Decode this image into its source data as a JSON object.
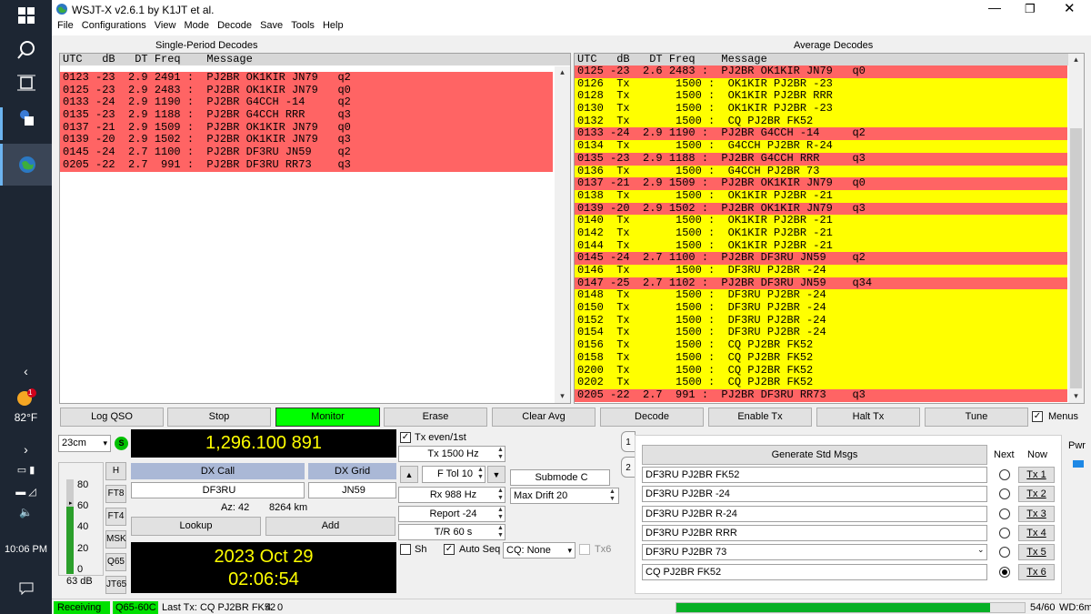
{
  "app": {
    "title": "WSJT-X   v2.6.1   by K1JT et al.",
    "menus": [
      "File",
      "Configurations",
      "View",
      "Mode",
      "Decode",
      "Save",
      "Tools",
      "Help"
    ]
  },
  "taskbar": {
    "temperature": "82°F",
    "time": "10:06 PM",
    "badge": "1"
  },
  "left_pane": {
    "title": "Single-Period Decodes",
    "header": "UTC   dB   DT Freq    Message",
    "rows": [
      {
        "text": "0123 -23  2.9 2491 :  PJ2BR OK1KIR JN79   q2",
        "color": "red"
      },
      {
        "text": "0125 -23  2.9 2483 :  PJ2BR OK1KIR JN79   q0",
        "color": "red"
      },
      {
        "text": "0133 -24  2.9 1190 :  PJ2BR G4CCH -14     q2",
        "color": "red"
      },
      {
        "text": "0135 -23  2.9 1188 :  PJ2BR G4CCH RRR     q3",
        "color": "red"
      },
      {
        "text": "0137 -21  2.9 1509 :  PJ2BR OK1KIR JN79   q0",
        "color": "red"
      },
      {
        "text": "0139 -20  2.9 1502 :  PJ2BR OK1KIR JN79   q3",
        "color": "red"
      },
      {
        "text": "0145 -24  2.7 1100 :  PJ2BR DF3RU JN59    q2",
        "color": "red"
      },
      {
        "text": "0205 -22  2.7  991 :  PJ2BR DF3RU RR73    q3",
        "color": "red"
      }
    ]
  },
  "right_pane": {
    "title": "Average Decodes",
    "header": "UTC   dB   DT Freq    Message",
    "rows": [
      {
        "text": "0125 -23  2.6 2483 :  PJ2BR OK1KIR JN79   q0",
        "color": "red"
      },
      {
        "text": "0126  Tx       1500 :  OK1KIR PJ2BR -23",
        "color": "yel"
      },
      {
        "text": "0128  Tx       1500 :  OK1KIR PJ2BR RRR",
        "color": "yel"
      },
      {
        "text": "0130  Tx       1500 :  OK1KIR PJ2BR -23",
        "color": "yel"
      },
      {
        "text": "0132  Tx       1500 :  CQ PJ2BR FK52",
        "color": "yel"
      },
      {
        "text": "0133 -24  2.9 1190 :  PJ2BR G4CCH -14     q2",
        "color": "red"
      },
      {
        "text": "0134  Tx       1500 :  G4CCH PJ2BR R-24",
        "color": "yel"
      },
      {
        "text": "0135 -23  2.9 1188 :  PJ2BR G4CCH RRR     q3",
        "color": "red"
      },
      {
        "text": "0136  Tx       1500 :  G4CCH PJ2BR 73",
        "color": "yel"
      },
      {
        "text": "0137 -21  2.9 1509 :  PJ2BR OK1KIR JN79   q0",
        "color": "red"
      },
      {
        "text": "0138  Tx       1500 :  OK1KIR PJ2BR -21",
        "color": "yel"
      },
      {
        "text": "0139 -20  2.9 1502 :  PJ2BR OK1KIR JN79   q3",
        "color": "red"
      },
      {
        "text": "0140  Tx       1500 :  OK1KIR PJ2BR -21",
        "color": "yel"
      },
      {
        "text": "0142  Tx       1500 :  OK1KIR PJ2BR -21",
        "color": "yel"
      },
      {
        "text": "0144  Tx       1500 :  OK1KIR PJ2BR -21",
        "color": "yel"
      },
      {
        "text": "0145 -24  2.7 1100 :  PJ2BR DF3RU JN59    q2",
        "color": "red"
      },
      {
        "text": "0146  Tx       1500 :  DF3RU PJ2BR -24",
        "color": "yel"
      },
      {
        "text": "0147 -25  2.7 1102 :  PJ2BR DF3RU JN59    q34",
        "color": "red"
      },
      {
        "text": "0148  Tx       1500 :  DF3RU PJ2BR -24",
        "color": "yel"
      },
      {
        "text": "0150  Tx       1500 :  DF3RU PJ2BR -24",
        "color": "yel"
      },
      {
        "text": "0152  Tx       1500 :  DF3RU PJ2BR -24",
        "color": "yel"
      },
      {
        "text": "0154  Tx       1500 :  DF3RU PJ2BR -24",
        "color": "yel"
      },
      {
        "text": "0156  Tx       1500 :  CQ PJ2BR FK52",
        "color": "yel"
      },
      {
        "text": "0158  Tx       1500 :  CQ PJ2BR FK52",
        "color": "yel"
      },
      {
        "text": "0200  Tx       1500 :  CQ PJ2BR FK52",
        "color": "yel"
      },
      {
        "text": "0202  Tx       1500 :  CQ PJ2BR FK52",
        "color": "yel"
      },
      {
        "text": "0205 -22  2.7  991 :  PJ2BR DF3RU RR73    q3",
        "color": "red"
      }
    ]
  },
  "buttons": {
    "log_qso": "Log QSO",
    "stop": "Stop",
    "monitor": "Monitor",
    "erase": "Erase",
    "clear_avg": "Clear Avg",
    "decode": "Decode",
    "enable_tx": "Enable Tx",
    "halt_tx": "Halt Tx",
    "tune": "Tune",
    "menus": "Menus"
  },
  "controls": {
    "band": "23cm",
    "s_label": "S",
    "frequency": "1,296.100 891",
    "dx_call_label": "DX Call",
    "dx_grid_label": "DX Grid",
    "dx_call": "DF3RU",
    "dx_grid": "JN59",
    "az": "Az: 42",
    "dist": "8264 km",
    "lookup": "Lookup",
    "add": "Add",
    "date": "2023 Oct 29",
    "time": "02:06:54",
    "mode_buttons": [
      "H",
      "FT8",
      "FT4",
      "MSK",
      "Q65",
      "JT65"
    ],
    "meter_ticks": [
      "80",
      "60",
      "40",
      "20",
      "0"
    ],
    "meter_level": "63 dB",
    "tx_even": "Tx even/1st",
    "tx_freq": "Tx  1500  Hz",
    "ftol": "F Tol  10",
    "rx_freq": "Rx  988  Hz",
    "report": "Report -24",
    "tr": "T/R  60  s",
    "submode": "Submode C",
    "max_drift": "Max Drift  20",
    "sh": "Sh",
    "auto_seq": "Auto Seq",
    "cq": "CQ: None",
    "tx6": "Tx6"
  },
  "tabs": [
    "1",
    "2"
  ],
  "msgs": {
    "generate": "Generate Std Msgs",
    "next": "Next",
    "now": "Now",
    "pwr": "Pwr",
    "items": [
      {
        "text": "DF3RU PJ2BR FK52",
        "btn": "Tx 1",
        "selected": false
      },
      {
        "text": "DF3RU PJ2BR -24",
        "btn": "Tx 2",
        "selected": false
      },
      {
        "text": "DF3RU PJ2BR R-24",
        "btn": "Tx 3",
        "selected": false
      },
      {
        "text": "DF3RU PJ2BR RRR",
        "btn": "Tx 4",
        "selected": false
      },
      {
        "text": "DF3RU PJ2BR 73",
        "btn": "Tx 5",
        "selected": false
      },
      {
        "text": "CQ PJ2BR FK52",
        "btn": "Tx 6",
        "selected": true
      }
    ]
  },
  "status": {
    "receiving": "Receiving",
    "mode": "Q65-60C",
    "last_tx": "Last Tx: CQ PJ2BR FK52",
    "n1": "4",
    "n2": "0",
    "progress_text": "54/60",
    "wd": "WD:6m",
    "progress": 0.9
  },
  "colors": {
    "red": "#ff6464",
    "yellow": "#ffff00",
    "monitor": "#00ff00",
    "receiving": "#00e000"
  }
}
